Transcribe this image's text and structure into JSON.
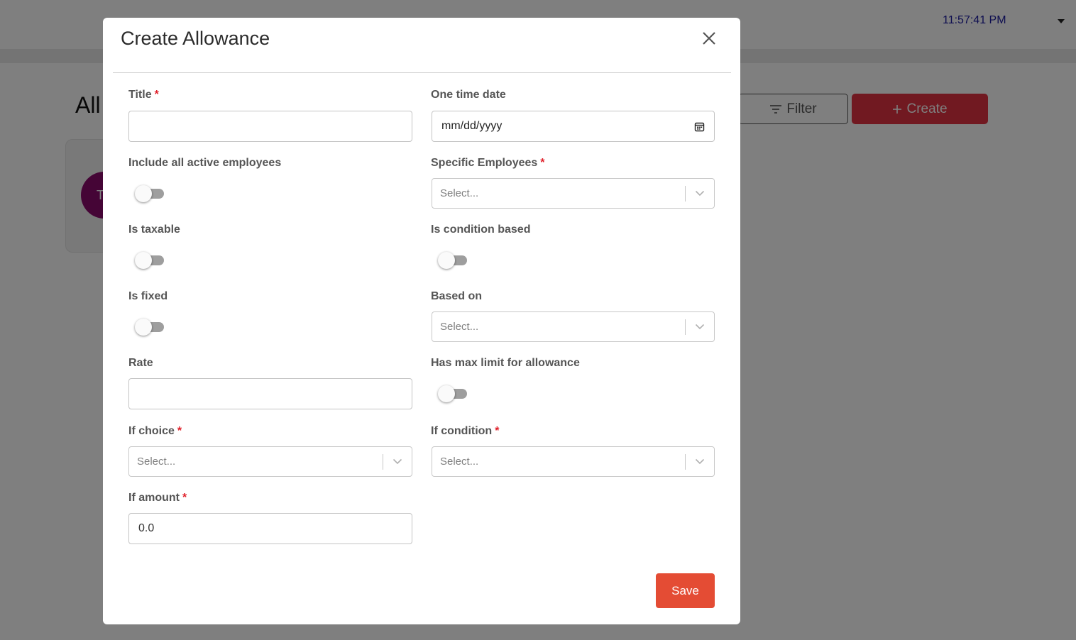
{
  "background": {
    "clock": "11:57:41 PM",
    "heading_partial": "All",
    "avatar_initial": "T",
    "filter_label": "Filter",
    "create_label": "Create",
    "create_color": "#e23343"
  },
  "modal": {
    "title": "Create Allowance",
    "fields": {
      "title": {
        "label": "Title",
        "required": "*",
        "value": ""
      },
      "one_time_date": {
        "label": "One time date",
        "placeholder": "mm/dd/yyyy"
      },
      "include_all_active": {
        "label": "Include all active employees",
        "on": false
      },
      "specific_employees": {
        "label": "Specific Employees",
        "required": "*",
        "placeholder": "Select..."
      },
      "is_taxable": {
        "label": "Is taxable",
        "on": false
      },
      "is_condition_based": {
        "label": "Is condition based",
        "on": false
      },
      "is_fixed": {
        "label": "Is fixed",
        "on": false
      },
      "based_on": {
        "label": "Based on",
        "placeholder": "Select..."
      },
      "rate": {
        "label": "Rate",
        "value": ""
      },
      "has_max_limit": {
        "label": "Has max limit for allowance",
        "on": false
      },
      "if_choice": {
        "label": "If choice",
        "required": "*",
        "placeholder": "Select..."
      },
      "if_condition": {
        "label": "If condition",
        "required": "*",
        "placeholder": "Select..."
      },
      "if_amount": {
        "label": "If amount",
        "required": "*",
        "value": "0.0"
      }
    },
    "save_label": "Save",
    "save_color": "#e44c34"
  },
  "icons": {
    "close": "close-icon",
    "calendar": "calendar-icon",
    "chevron": "chevron-down-icon",
    "filter": "filter-icon",
    "plus": "plus-icon",
    "caret": "caret-down-icon"
  }
}
